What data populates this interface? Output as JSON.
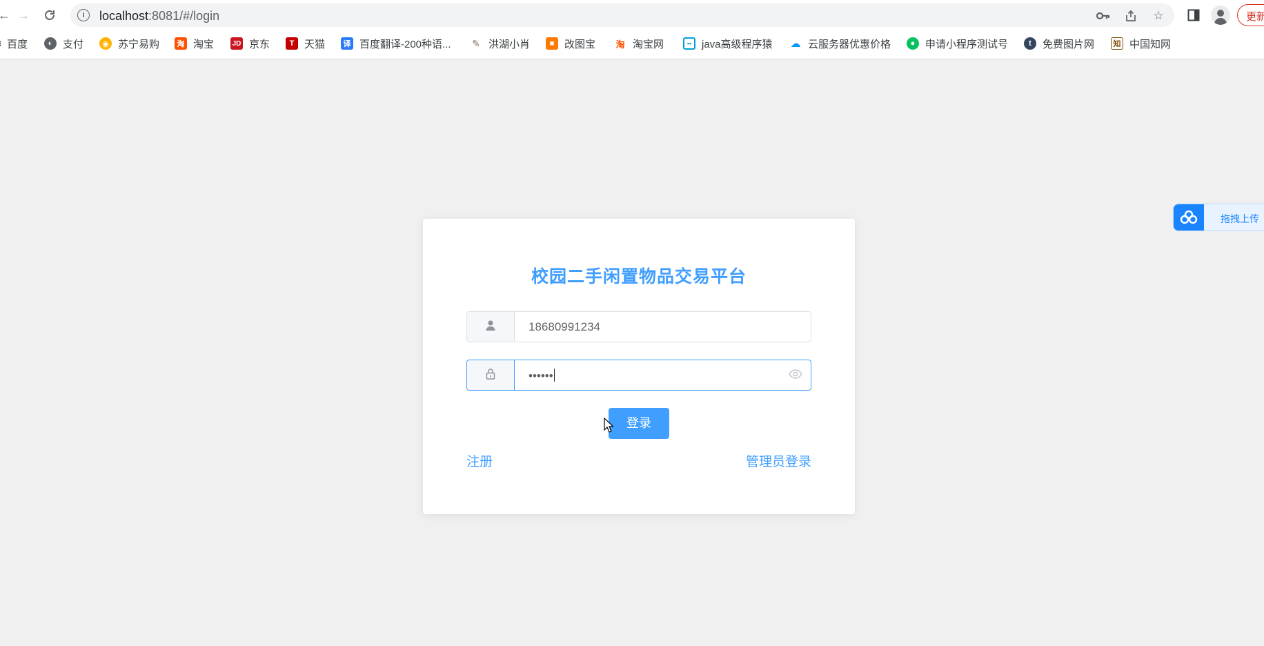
{
  "browser": {
    "url_host": "localhost",
    "url_path": ":8081/#/login",
    "update_label": "更新",
    "bookmarks": [
      {
        "label": "百度",
        "icon": "baidu-icon",
        "color": "#2932e1"
      },
      {
        "label": "支付",
        "icon": "globe-icon",
        "color": "#5f6368"
      },
      {
        "label": "苏宁易购",
        "icon": "suning-icon",
        "color": "#ffb300"
      },
      {
        "label": "淘宝",
        "icon": "taobao-icon",
        "color": "#ff5000"
      },
      {
        "label": "京东",
        "icon": "jd-icon",
        "color": "#c91623"
      },
      {
        "label": "天猫",
        "icon": "tmall-icon",
        "color": "#c40000"
      },
      {
        "label": "百度翻译-200种语...",
        "icon": "translate-icon",
        "color": "#2b7bf6"
      },
      {
        "label": "洪湖小肖",
        "icon": "bird-icon",
        "color": "#8d6e63"
      },
      {
        "label": "改图宝",
        "icon": "gaitubao-icon",
        "color": "#ff7a00"
      },
      {
        "label": "淘宝网",
        "icon": "taobao-icon",
        "color": "#ff5000"
      },
      {
        "label": "java高级程序猿",
        "icon": "bilibili-icon",
        "color": "#00a1d6"
      },
      {
        "label": "云服务器优惠价格",
        "icon": "cloud-icon",
        "color": "#0095ff"
      },
      {
        "label": "申请小程序测试号",
        "icon": "wechat-icon",
        "color": "#07c160"
      },
      {
        "label": "免费图片网",
        "icon": "tumblr-icon",
        "color": "#35465c"
      },
      {
        "label": "中国知网",
        "icon": "cnki-icon",
        "color": "#7a4a00"
      }
    ]
  },
  "login": {
    "title": "校园二手闲置物品交易平台",
    "username_value": "18680991234",
    "password_value": "••••••",
    "login_button": "登录",
    "register_link": "注册",
    "admin_link": "管理员登录",
    "accent_color": "#409eff"
  },
  "float_widget": {
    "label": "拖拽上传"
  }
}
